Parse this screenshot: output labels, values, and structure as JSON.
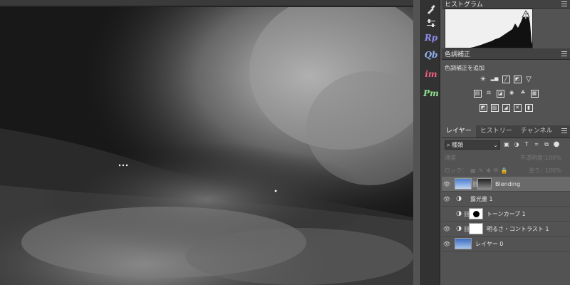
{
  "tools": [
    {
      "label": "Rp",
      "color": "#8d8df0"
    },
    {
      "label": "Qb",
      "color": "#8fb0f0"
    },
    {
      "label": "im",
      "color": "#f06080"
    },
    {
      "label": "Pm",
      "color": "#8fe08f"
    }
  ],
  "histogram": {
    "title": "ヒストグラム",
    "warning": "!"
  },
  "adjustments": {
    "title": "色調補正",
    "add_label": "色調補正を追加"
  },
  "layers_panel": {
    "tabs": [
      "レイヤー",
      "ヒストリー",
      "チャンネル"
    ],
    "filter_kind": "種類",
    "blend_mode": "通常",
    "opacity_label": "不透明度：",
    "opacity_value": "100%",
    "lock_label": "ロック：",
    "fill_label": "塗り：",
    "fill_value": "100%",
    "layers": [
      {
        "name": "Blending",
        "visible": true,
        "selected": true
      },
      {
        "name": "露光量 1",
        "visible": true,
        "selected": false
      },
      {
        "name": "トーンカーブ 1",
        "visible": false,
        "selected": false
      },
      {
        "name": "明るさ・コントラスト 1",
        "visible": true,
        "selected": false
      },
      {
        "name": "レイヤー 0",
        "visible": true,
        "selected": false
      }
    ]
  }
}
